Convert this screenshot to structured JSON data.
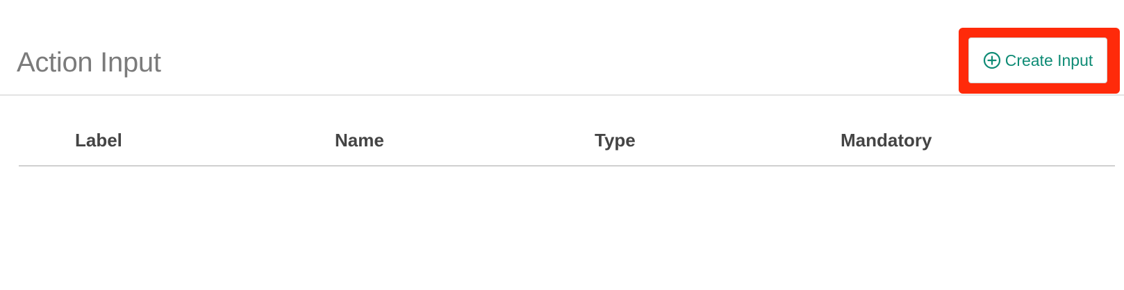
{
  "page": {
    "title": "Action Input"
  },
  "toolbar": {
    "create_label": "Create Input",
    "create_icon": "plus-circle-icon"
  },
  "table": {
    "columns": [
      "Label",
      "Name",
      "Type",
      "Mandatory"
    ],
    "rows": []
  },
  "colors": {
    "accent": "#0e8b75",
    "highlight": "#ff2a0a",
    "title": "#7b7b7b",
    "header_text": "#444444"
  }
}
